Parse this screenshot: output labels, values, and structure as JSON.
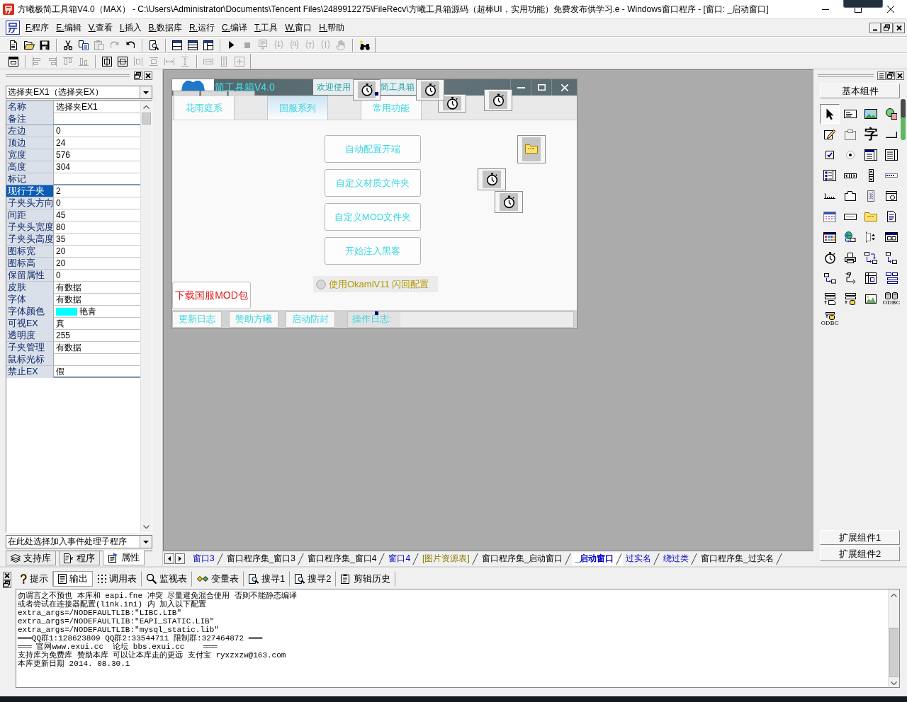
{
  "window": {
    "title": "方曦极简工具箱V4.0（MAX） - C:\\Users\\Administrator\\Documents\\Tencent Files\\2489912275\\FileRecv\\方曦工具箱源码（超棒UI，实用功能）免费发布供学习.e - Windows窗口程序 - [窗口: _启动窗口]"
  },
  "menu": [
    "F.程序",
    "E.编辑",
    "V.查看",
    "I.插入",
    "B.数据库",
    "R.运行",
    "C.编译",
    "T.工具",
    "W.窗口",
    "H.帮助"
  ],
  "toolbars": [
    {
      "groups": [
        [
          {
            "kind": "new",
            "disabled": false
          },
          {
            "kind": "open",
            "disabled": false
          },
          {
            "kind": "save",
            "disabled": false
          }
        ],
        [
          {
            "kind": "cut",
            "disabled": false
          },
          {
            "kind": "copy",
            "disabled": false
          },
          {
            "kind": "paste",
            "disabled": true
          },
          {
            "kind": "redo",
            "disabled": true
          },
          {
            "kind": "undo",
            "disabled": false
          }
        ],
        [
          {
            "kind": "find",
            "disabled": false
          }
        ],
        [
          {
            "kind": "layout_top",
            "disabled": false
          },
          {
            "kind": "layout_bottom",
            "disabled": false
          },
          {
            "kind": "layout_side",
            "disabled": false
          }
        ],
        [
          {
            "kind": "run",
            "disabled": false
          },
          {
            "kind": "stop",
            "disabled": true
          },
          {
            "kind": "step_screen",
            "disabled": true
          },
          {
            "kind": "step_in",
            "disabled": true
          },
          {
            "kind": "step_over",
            "disabled": true
          },
          {
            "kind": "step_out",
            "disabled": true
          },
          {
            "kind": "step_cursor",
            "disabled": true
          },
          {
            "kind": "hand",
            "disabled": true
          }
        ],
        [
          {
            "kind": "binoculars",
            "disabled": false
          }
        ]
      ]
    },
    {
      "groups": [
        [
          {
            "kind": "form",
            "disabled": false
          }
        ],
        [
          {
            "kind": "align_left",
            "disabled": true
          },
          {
            "kind": "align_right",
            "disabled": true
          },
          {
            "kind": "align_top",
            "disabled": true
          },
          {
            "kind": "align_bottom",
            "disabled": true
          }
        ],
        [
          {
            "kind": "center_h",
            "disabled": false
          },
          {
            "kind": "center_v",
            "disabled": false
          },
          {
            "kind": "space_h",
            "disabled": true
          },
          {
            "kind": "space_v",
            "disabled": true
          },
          {
            "kind": "space_eq_h",
            "disabled": true
          },
          {
            "kind": "space_eq_v",
            "disabled": true
          }
        ],
        [
          {
            "kind": "size_w",
            "disabled": true
          },
          {
            "kind": "size_h",
            "disabled": true
          },
          {
            "kind": "size_both",
            "disabled": true
          }
        ]
      ]
    }
  ],
  "properties_panel": {
    "object_selector": "选择夹EX1（选择夹EX）",
    "groups": [
      {
        "rows": [
          {
            "name": "名称",
            "value": "选择夹EX1",
            "selected": false
          },
          {
            "name": "备注",
            "selected": false
          }
        ]
      },
      {
        "rows": [
          {
            "name": "左边",
            "value": "0",
            "selected": false
          },
          {
            "name": "顶边",
            "value": "24",
            "selected": false
          },
          {
            "name": "宽度",
            "value": "576",
            "selected": false
          },
          {
            "name": "高度",
            "value": "304",
            "selected": false
          },
          {
            "name": "标记",
            "selected": false
          }
        ]
      },
      {
        "rows": [
          {
            "name": "现行子夹",
            "value": "2",
            "selected": true
          },
          {
            "name": "子夹头方向",
            "value": "0",
            "selected": false
          },
          {
            "name": "间距",
            "value": "45",
            "selected": false
          },
          {
            "name": "子夹头宽度",
            "value": "80",
            "selected": false
          },
          {
            "name": "子夹头高度",
            "value": "35",
            "selected": false
          },
          {
            "name": "图标宽",
            "value": "20",
            "selected": false
          },
          {
            "name": "图标高",
            "value": "20",
            "selected": false
          },
          {
            "name": "保留属性",
            "value": "0",
            "selected": false
          },
          {
            "name": "皮肤",
            "value": "有数据",
            "selected": false
          },
          {
            "name": "字体",
            "value": "有数据",
            "selected": false
          },
          {
            "name": "字体颜色",
            "value": "艳青",
            "color": "#00ffff",
            "selected": false
          },
          {
            "name": "可视EX",
            "value": "真",
            "selected": false
          },
          {
            "name": "透明度",
            "value": "255",
            "selected": false
          },
          {
            "name": "子夹管理",
            "value": "有数据",
            "selected": false
          },
          {
            "name": "鼠标光标",
            "selected": false
          },
          {
            "name": "禁止EX",
            "value": "假",
            "selected": false
          }
        ]
      }
    ],
    "event_selector": "在此处选择加入事件处理子程序",
    "tabs": [
      {
        "label": "支持库",
        "kind": "library",
        "selected": false
      },
      {
        "label": "程序",
        "kind": "program",
        "selected": false
      },
      {
        "label": "属性",
        "kind": "properties",
        "selected": true
      }
    ]
  },
  "designer": {
    "form": {
      "title": "简工具箱V4.0",
      "welcome_parts": [
        "欢迎使用",
        "简工具箱"
      ],
      "tabs": [
        {
          "label": "花雨庭系",
          "selected": false
        },
        {
          "label": "国服系列",
          "selected": true
        },
        {
          "label": "常用功能",
          "selected": false
        }
      ],
      "buttons": [
        "自动配置开端",
        "自定义材质文件夹",
        "自定义MOD文件夹",
        "开始注入黑客"
      ],
      "option": {
        "label": "使用OkamiV11 闪回配置",
        "checked": false
      },
      "download_button": "下载国服MOD包",
      "footer_buttons": [
        "更新日志",
        "赞助方曦",
        "启动防封"
      ],
      "log_label": "操作日志:"
    }
  },
  "document_tabs": [
    {
      "label": "窗口3",
      "kind": "form",
      "selected": false
    },
    {
      "label": "窗口程序集_窗口3",
      "kind": "module",
      "selected": false
    },
    {
      "label": "窗口程序集_窗口4",
      "kind": "module",
      "selected": false
    },
    {
      "label": "窗口4",
      "kind": "form",
      "selected": false
    },
    {
      "label": "[图片资源表]",
      "kind": "resource",
      "selected": false
    },
    {
      "label": "窗口程序集_启动窗口",
      "kind": "module",
      "selected": false
    },
    {
      "label": "_启动窗口",
      "kind": "form",
      "selected": true
    },
    {
      "label": "过实名",
      "kind": "form",
      "selected": false
    },
    {
      "label": "绕过类",
      "kind": "form",
      "selected": false
    },
    {
      "label": "窗口程序集_过实名",
      "kind": "module",
      "selected": false
    }
  ],
  "components_panel": {
    "title": "基本组件",
    "items": [
      {
        "kind": "pointer",
        "selected": true
      },
      {
        "kind": "label",
        "selected": false
      },
      {
        "kind": "picture",
        "selected": false
      },
      {
        "kind": "shapes",
        "selected": false
      },
      {
        "kind": "edit",
        "selected": false
      },
      {
        "kind": "frame",
        "selected": false
      },
      {
        "kind": "glyph",
        "glyph": "字",
        "selected": false
      },
      {
        "kind": "corner",
        "selected": false
      },
      {
        "kind": "checkbox",
        "selected": false
      },
      {
        "kind": "radio",
        "selected": false
      },
      {
        "kind": "combo",
        "selected": false
      },
      {
        "kind": "list",
        "selected": false
      },
      {
        "kind": "listview",
        "selected": false
      },
      {
        "kind": "hscroll",
        "selected": false
      },
      {
        "kind": "vscroll",
        "selected": false
      },
      {
        "kind": "progress",
        "selected": false
      },
      {
        "kind": "ruler",
        "selected": false
      },
      {
        "kind": "tab",
        "selected": false
      },
      {
        "kind": "film",
        "selected": false
      },
      {
        "kind": "window_circle",
        "selected": false
      },
      {
        "kind": "calendar",
        "selected": false
      },
      {
        "kind": "input",
        "selected": false
      },
      {
        "kind": "folder",
        "selected": false
      },
      {
        "kind": "document",
        "selected": false
      },
      {
        "kind": "colorgrid",
        "selected": false
      },
      {
        "kind": "globe",
        "selected": false
      },
      {
        "kind": "spin",
        "selected": false
      },
      {
        "kind": "panel",
        "selected": false
      },
      {
        "kind": "stopwatch",
        "selected": false
      },
      {
        "kind": "printer",
        "selected": false
      },
      {
        "kind": "net1",
        "selected": false
      },
      {
        "kind": "net2",
        "selected": false
      },
      {
        "kind": "net3",
        "selected": false
      },
      {
        "kind": "cable",
        "selected": false
      },
      {
        "kind": "table",
        "selected": false
      },
      {
        "kind": "toolbar",
        "selected": false
      },
      {
        "kind": "datasource",
        "selected": false
      },
      {
        "kind": "database",
        "selected": false
      },
      {
        "kind": "chart",
        "selected": false
      },
      {
        "kind": "odbc_pair",
        "caption": "ODBC",
        "selected": false
      },
      {
        "kind": "odbc_single",
        "caption": "ODBC",
        "selected": false
      }
    ],
    "groups": [
      "扩展组件1",
      "扩展组件2"
    ]
  },
  "output_panel": {
    "tabs": [
      {
        "label": "提示",
        "kind": "hint",
        "selected": false
      },
      {
        "label": "输出",
        "kind": "output",
        "selected": true
      },
      {
        "label": "调用表",
        "kind": "call_stack",
        "selected": false
      },
      {
        "label": "监视表",
        "kind": "watch",
        "selected": false
      },
      {
        "label": "变量表",
        "kind": "variables",
        "selected": false
      },
      {
        "label": "搜寻1",
        "kind": "search",
        "selected": false
      },
      {
        "label": "搜寻2",
        "kind": "search",
        "selected": false
      },
      {
        "label": "剪辑历史",
        "kind": "clip_history",
        "selected": false
      }
    ],
    "lines": [
      "勿谓言之不预也 本库和 eapi.fne 冲突 尽量避免混合使用 否则不能静态编译",
      "或者尝试在连接器配置(link.ini) 内 加入以下配置",
      "extra_args=/NODEFAULTLIB:\"LIBC.LIB\"",
      "extra_args=/NODEFAULTLIB:\"EAPI_STATIC.LIB\"",
      "extra_args=/NODEFAULTLIB:\"mysql_static.lib\"",
      "═══QQ群1:128623809 QQ群2:33544711 限制群:327464872 ═══",
      "═══ 官网www.exui.cc  论坛 bbs.exui.cc    ═══",
      "支持库为免费库 赞助本库 可以让本库走的更远 支付宝 ryxzxzw@163.com",
      "本库更新日期 2014. 08.30.1"
    ]
  }
}
